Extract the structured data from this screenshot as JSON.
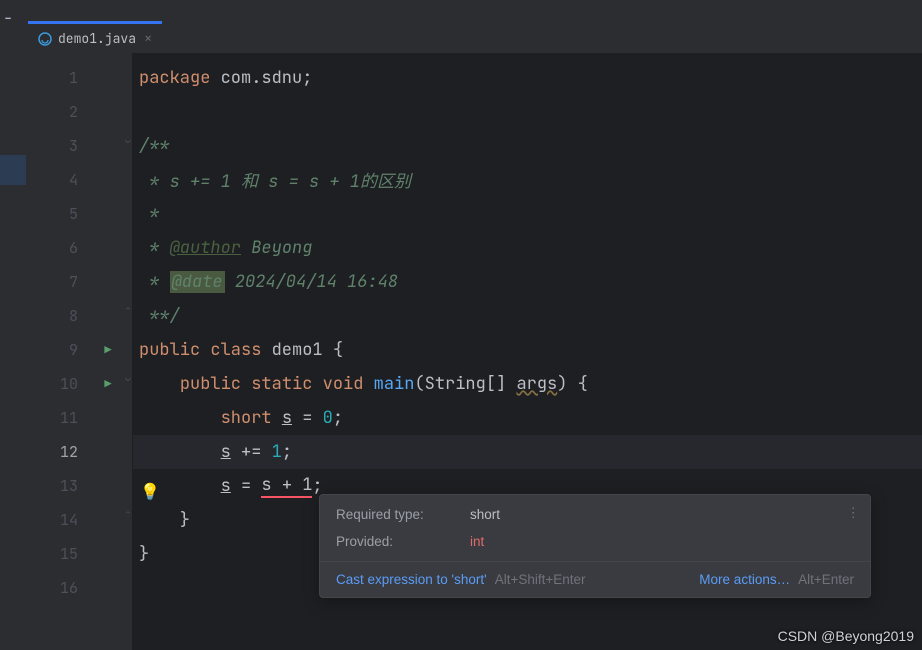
{
  "tab": {
    "filename": "demo1.java",
    "close_glyph": "×"
  },
  "gutter": {
    "lines": [
      "1",
      "2",
      "3",
      "4",
      "5",
      "6",
      "7",
      "8",
      "9",
      "10",
      "11",
      "12",
      "13",
      "14",
      "15",
      "16"
    ],
    "current": 12
  },
  "code": {
    "l1_package": "package",
    "l1_pkg": " com.sdnu",
    "l1_semi": ";",
    "l3": "/**",
    "l4": " * s += 1 和 s = s + 1的区别",
    "l5": " *",
    "l6_pre": " * ",
    "l6_tag": "@author",
    "l6_post": " Beyong",
    "l7_pre": " * ",
    "l7_tag": "@date",
    "l7_post": " 2024/04/14 16:48",
    "l8": " **/",
    "l9_public": "public",
    "l9_class": " class",
    "l9_name": " demo1 ",
    "l9_brace": "{",
    "l10_ind": "    ",
    "l10_public": "public",
    "l10_static": " static",
    "l10_void": " void",
    "l10_main": " main",
    "l10_paren1": "(",
    "l10_type": "String",
    "l10_arr": "[] ",
    "l10_args": "args",
    "l10_paren2": ") {",
    "l11_ind": "        short ",
    "l11_s": "s",
    "l11_eq": " = ",
    "l11_zero": "0",
    "l11_semi": ";",
    "l12_ind": "        ",
    "l12_s": "s",
    "l12_op": " += ",
    "l12_one": "1",
    "l12_semi": ";",
    "l13_ind": "        ",
    "l13_s": "s",
    "l13_eq": " = ",
    "l13_err": "s + 1",
    "l13_semi": ";",
    "l14": "    }",
    "l15": "}"
  },
  "tooltip": {
    "required_label": "Required type:",
    "required_val": "short",
    "provided_label": "Provided:",
    "provided_val": "int",
    "fix_link": "Cast expression to 'short'",
    "fix_shortcut": "Alt+Shift+Enter",
    "more_link": "More actions…",
    "more_shortcut": "Alt+Enter",
    "menu_glyph": "⋮"
  },
  "watermark": "CSDN @Beyong2019"
}
